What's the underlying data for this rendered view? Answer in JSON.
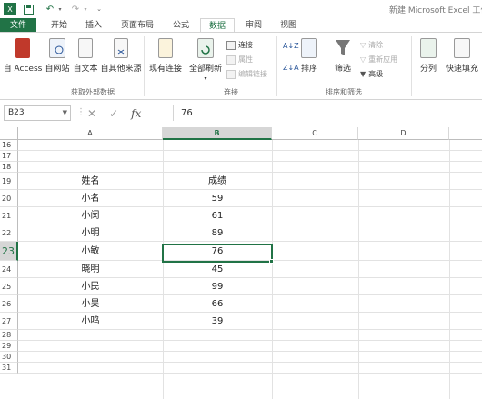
{
  "titlebar": {
    "title": "新建 Microsoft Excel 工作表"
  },
  "tabs": [
    {
      "label": "文件"
    },
    {
      "label": "开始"
    },
    {
      "label": "插入"
    },
    {
      "label": "页面布局"
    },
    {
      "label": "公式"
    },
    {
      "label": "数据"
    },
    {
      "label": "审阅"
    },
    {
      "label": "视图"
    }
  ],
  "ribbon": {
    "get_external": {
      "label": "获取外部数据",
      "buttons": [
        {
          "label": "自 Access"
        },
        {
          "label": "自网站"
        },
        {
          "label": "自文本"
        },
        {
          "label": "自其他来源"
        },
        {
          "label": "现有连接"
        }
      ]
    },
    "connections": {
      "label": "连接",
      "refresh_label": "全部刷新",
      "items": [
        {
          "label": "连接"
        },
        {
          "label": "属性"
        },
        {
          "label": "编辑链接"
        }
      ]
    },
    "sort_filter": {
      "label": "排序和筛选",
      "sort_label": "排序",
      "filter_label": "筛选",
      "items": [
        {
          "label": "清除"
        },
        {
          "label": "重新应用"
        },
        {
          "label": "高级"
        }
      ]
    },
    "tools": {
      "split_label": "分列",
      "flash_label": "快速填充"
    }
  },
  "formula_bar": {
    "name_box": "B23",
    "value": "76"
  },
  "grid": {
    "columns": [
      "A",
      "B",
      "C",
      "D"
    ],
    "selected_column": "B",
    "rows": [
      "16",
      "17",
      "18",
      "19",
      "20",
      "21",
      "22",
      "23",
      "24",
      "25",
      "26",
      "27",
      "28",
      "29",
      "30",
      "31"
    ],
    "selected_row": "23",
    "cells": [
      {
        "row": "19",
        "a": "姓名",
        "b": "成绩"
      },
      {
        "row": "20",
        "a": "小名",
        "b": "59"
      },
      {
        "row": "21",
        "a": "小闵",
        "b": "61"
      },
      {
        "row": "22",
        "a": "小明",
        "b": "89"
      },
      {
        "row": "23",
        "a": "小敏",
        "b": "76"
      },
      {
        "row": "24",
        "a": "晓明",
        "b": "45"
      },
      {
        "row": "25",
        "a": "小民",
        "b": "99"
      },
      {
        "row": "26",
        "a": "小昊",
        "b": "66"
      },
      {
        "row": "27",
        "a": "小鸣",
        "b": "39"
      }
    ]
  },
  "colors": {
    "accent": "#217346",
    "access_red": "#c0392b",
    "link_blue": "#2b579a"
  }
}
